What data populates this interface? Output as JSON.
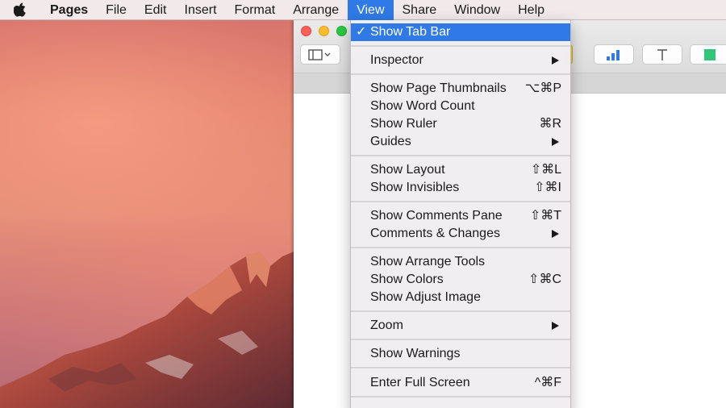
{
  "menubar": {
    "apple_icon": "apple-logo-icon",
    "items": [
      "Pages",
      "File",
      "Edit",
      "Insert",
      "Format",
      "Arrange",
      "View",
      "Share",
      "Window",
      "Help"
    ],
    "active": "View"
  },
  "window": {
    "toolbar_icons": [
      "sidebar-view-icon",
      "chart-icon",
      "text-box-icon",
      "shape-icon"
    ]
  },
  "view_menu": {
    "show_tab_bar": {
      "check": "✓",
      "label": "Show Tab Bar",
      "shortcut": ""
    },
    "inspector": {
      "label": "Inspector",
      "submenu": true
    },
    "show_page_thumbnails": {
      "label": "Show Page Thumbnails",
      "shortcut": "⌥⌘P"
    },
    "show_word_count": {
      "label": "Show Word Count",
      "shortcut": ""
    },
    "show_ruler": {
      "label": "Show Ruler",
      "shortcut": "⌘R"
    },
    "guides": {
      "label": "Guides",
      "submenu": true
    },
    "show_layout": {
      "label": "Show Layout",
      "shortcut": "⇧⌘L"
    },
    "show_invisibles": {
      "label": "Show Invisibles",
      "shortcut": "⇧⌘I"
    },
    "show_comments_pane": {
      "label": "Show Comments Pane",
      "shortcut": "⇧⌘T"
    },
    "comments_changes": {
      "label": "Comments & Changes",
      "submenu": true
    },
    "show_arrange_tools": {
      "label": "Show Arrange Tools",
      "shortcut": ""
    },
    "show_colors": {
      "label": "Show Colors",
      "shortcut": "⇧⌘C"
    },
    "show_adjust_image": {
      "label": "Show Adjust Image",
      "shortcut": ""
    },
    "zoom": {
      "label": "Zoom",
      "submenu": true
    },
    "show_warnings": {
      "label": "Show Warnings",
      "shortcut": ""
    },
    "enter_full_screen": {
      "label": "Enter Full Screen",
      "shortcut": "^⌘F"
    }
  },
  "colors": {
    "highlight": "#2f7ae6",
    "close": "#fc5f57",
    "minimize": "#fdbb2e",
    "zoom": "#29c841"
  }
}
